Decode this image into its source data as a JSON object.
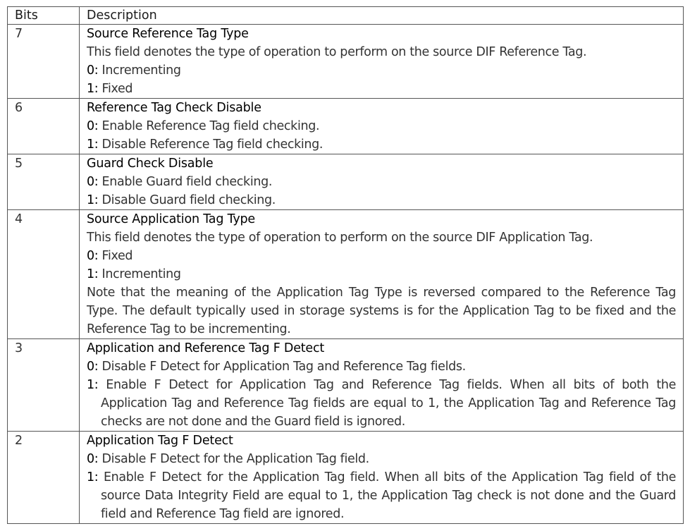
{
  "headers": {
    "bits": "Bits",
    "description": "Description"
  },
  "rows": [
    {
      "bit": "7",
      "title": "Source Reference Tag Type",
      "intro": "This field denotes the type of operation to perform on the source DIF Reference Tag.",
      "opt0_key": "0:",
      "opt0_text": " Incrementing",
      "opt1_key": "1:",
      "opt1_text": " Fixed"
    },
    {
      "bit": "6",
      "title": "Reference Tag Check Disable",
      "opt0_key": "0:",
      "opt0_text": " Enable Reference Tag field checking.",
      "opt1_key": "1:",
      "opt1_text": " Disable Reference Tag field checking."
    },
    {
      "bit": "5",
      "title": "Guard Check Disable",
      "opt0_key": "0:",
      "opt0_text": " Enable Guard field checking.",
      "opt1_key": "1:",
      "opt1_text": " Disable Guard field checking."
    },
    {
      "bit": "4",
      "title": "Source Application Tag Type",
      "intro": "This field denotes the type of operation to perform on the source DIF Application Tag.",
      "opt0_key": "0:",
      "opt0_text": " Fixed",
      "opt1_key": "1:",
      "opt1_text": " Incrementing",
      "note": "Note that the meaning of the Application Tag Type is reversed compared to the Reference Tag Type. The default typically used in storage systems is for the Application Tag to be fixed and the Reference Tag to be incrementing."
    },
    {
      "bit": "3",
      "title": "Application and Reference Tag F Detect",
      "opt0_key": "0:",
      "opt0_text": " Disable F Detect for Application Tag and Reference Tag fields.",
      "opt1_key": "1:",
      "opt1_text": " Enable F Detect for Application Tag and Reference Tag fields. When all bits of both the Application Tag and Reference Tag fields are equal to 1, the Application Tag and Reference Tag checks are not done and the Guard field is ignored."
    },
    {
      "bit": "2",
      "title": "Application Tag F Detect",
      "opt0_key": "0:",
      "opt0_text": " Disable F Detect for the Application Tag field.",
      "opt1_key": "1:",
      "opt1_text": " Enable F Detect for the Application Tag field. When all bits of the Application Tag field of the source Data Integrity Field are equal to 1, the Application Tag check is not done and the Guard field and Reference Tag field are ignored."
    }
  ]
}
